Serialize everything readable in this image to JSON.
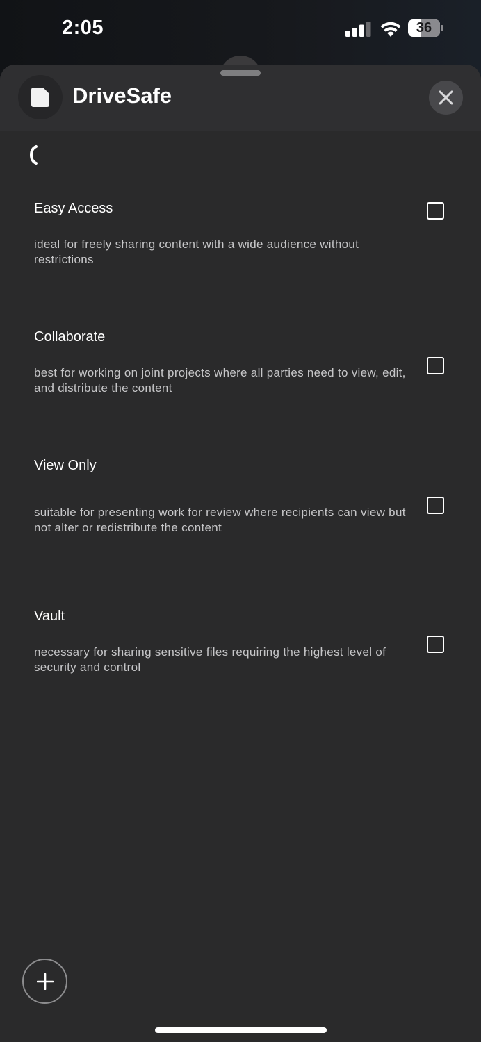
{
  "status_bar": {
    "time": "2:05",
    "battery_level": "36",
    "signal_icon": "cellular-signal-icon",
    "wifi_icon": "wifi-icon",
    "battery_icon": "battery-icon"
  },
  "header": {
    "app_title": "DriveSafe",
    "app_icon": "file-icon",
    "close_icon": "close-icon"
  },
  "navigation": {
    "back_icon": "back-chevron-icon"
  },
  "options": [
    {
      "title": "Easy Access",
      "description": "ideal for freely sharing content with a wide audience without restrictions",
      "checked": false
    },
    {
      "title": "Collaborate",
      "description": "best for working on joint projects where all parties need to view, edit, and distribute the content",
      "checked": false
    },
    {
      "title": "View Only",
      "description": "suitable for presenting work for review where recipients can view but not alter or redistribute the content",
      "checked": false
    },
    {
      "title": "Vault",
      "description": "necessary for sharing sensitive files requiring the highest level of security and control",
      "checked": false
    }
  ],
  "fab": {
    "icon": "sparkle-icon"
  },
  "colors": {
    "sheet_background": "#2a2a2b",
    "header_background": "#2f2f31",
    "text_primary": "#ffffff",
    "text_secondary": "#c6c6c8"
  }
}
